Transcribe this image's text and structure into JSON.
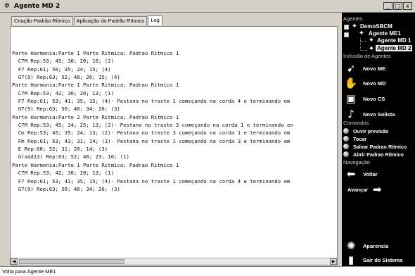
{
  "window": {
    "title": "Agente MD 2",
    "controls": {
      "minimize": "_",
      "maximize": "□",
      "close": "x"
    }
  },
  "tabs": [
    {
      "label": "Criação Padrão Rítmico"
    },
    {
      "label": "Aplicação do Padrão Rítmico"
    },
    {
      "label": "Log"
    }
  ],
  "log": {
    "lines": [
      "Parte Harmonia:Parte 1 Parte Ritmica: Padrao Ritmico 1",
      "  C7M Rep:53; 45; 30; 20; 10; (2)",
      "  F7 Rep:61; 50; 35; 24; 15; (4)",
      "  G7(9) Rep:63; 52; 40; 26; 15; (4)",
      "Parte Harmonia:Parte 1 Parte Ritmica: Padrao Ritmico 1",
      "  C7M Rep:53; 42; 30; 20; 13; (1)",
      "  F7 Rep:61; 53; 41; 35; 15; (4)- Pestana no traste 1 começando na corda 4 e terminando em",
      "  G7(9) Rep:63; 50; 40; 34; 26; (3)",
      "Parte Harmonia:Parte 2 Parte Ritmica: Padrao Ritmico 1",
      "  C7M Rep:53; 45; 34; 25; 13; (2)- Pestana no traste 3 começando na corda 1 e terminando en",
      "  Cm Rep:53; 45; 35; 24; 13; (2)- Pestana no traste 3 começando na corda 1 e terminando em",
      "  Fm Rep:61; 53; 43; 31; 14; (3)- Pestana no traste 1 começando na corda 3 e terminando em",
      "  E Rep:60; 52; 31; 20; 14; (3)",
      "  G(add13) Rep:63; 52; 40; 23; 10; (1)",
      "Parte Harmonia:Parte 1 Parte Ritmica: Padrao Ritmico 1",
      "  C7M Rep:53; 42; 30; 20; 13; (1)",
      "  F7 Rep:61; 53; 41; 35; 15; (4)- Pestana no traste 1 começando na corda 4 e terminando em",
      "  G7(9) Rep:63; 50; 40; 34; 26; (3)"
    ]
  },
  "status": {
    "text": "Volta para Agente ME1"
  },
  "sidebar": {
    "agents_label": "Agentes",
    "tree": {
      "root": "DemoSBCM",
      "child": "Agente ME1",
      "leaf1": "Agente MD 1",
      "leaf2": "Agente MD 2"
    },
    "inclusion_label": "Inclusão de Agentes",
    "inclusion": [
      {
        "label": "Novo ME",
        "icon": "runner-icon"
      },
      {
        "label": "Novo MD",
        "icon": "hand-icon"
      },
      {
        "label": "Novo CS",
        "icon": "cs-icon"
      },
      {
        "label": "Novo Solista",
        "icon": "guitar-icon"
      }
    ],
    "commands_label": "Comandos",
    "commands": [
      {
        "label": "Ouvir previsão"
      },
      {
        "label": "Tocar"
      },
      {
        "label": "Salvar Padrao Ritmico"
      },
      {
        "label": "Abrir Padrao Ritmico"
      }
    ],
    "navigation_label": "Navegação",
    "navigation": {
      "back": "Voltar",
      "forward": "Avançar"
    },
    "appearance": "Aparencia",
    "exit": "Sair do Sistema"
  }
}
